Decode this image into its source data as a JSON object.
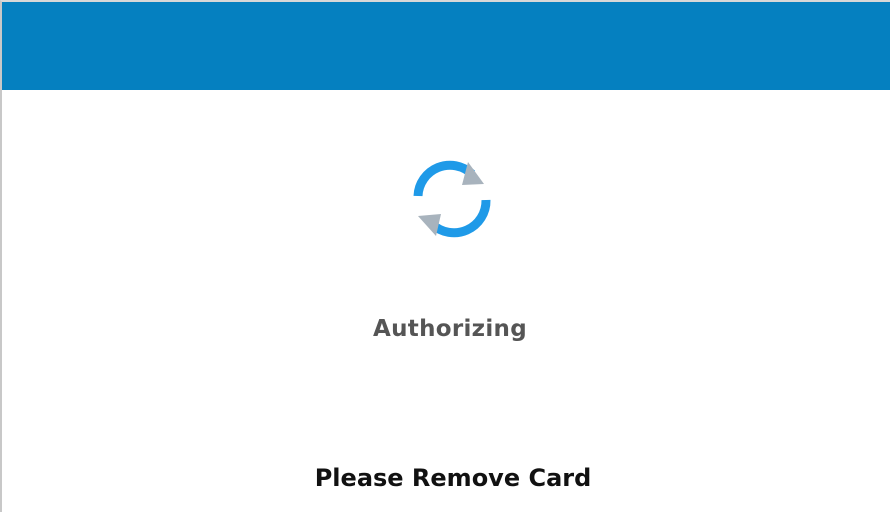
{
  "header": {
    "color": "#0580c0"
  },
  "spinner": {
    "icon": "refresh-icon",
    "color": "#1f9ae8"
  },
  "status": {
    "label": "Authorizing"
  },
  "prompt": {
    "label": "Please Remove Card"
  }
}
